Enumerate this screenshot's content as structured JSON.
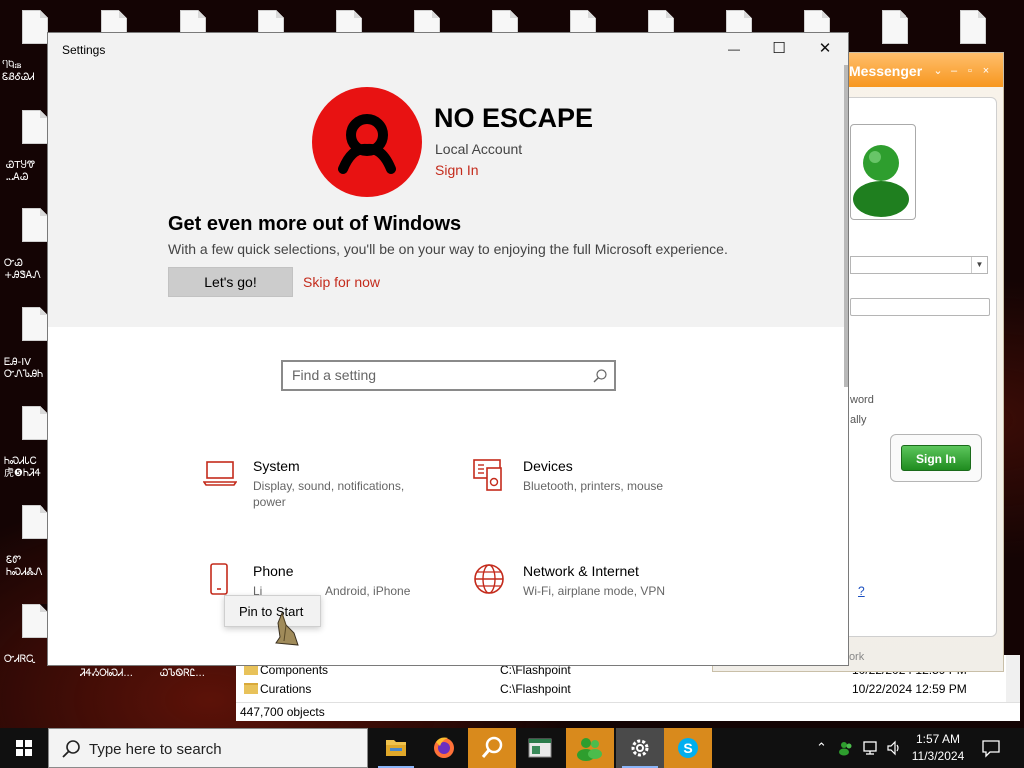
{
  "desktop": {
    "labels": [
      "ႤႩ᎓ᏼ\nᏋᏰᎴᏊᏗ",
      "ᏯTႸᏡ\n᎐᎑ᎪᏊ",
      "ᏅᏊ\n+ᎯᏕᎪᏁ",
      "ᎬᎯ-IV\nᏅᏁᏖᎯᏂ",
      "ᏂᏍᏗᏓᏟ\n虎❺ᏂᏘᏎ",
      "ᏋᏛ\nᏂᏍᏗᏜᏁ",
      "ᏅᏗᏒᏩ",
      "ᏘᏎᏱᎺᏍᏗ...",
      "ᏇᏖᏫᏒᏝ..."
    ]
  },
  "explorer": {
    "rows": [
      {
        "name": "Components",
        "path": "C:\\Flashpoint",
        "date": "10/22/2024 12:59 PM"
      },
      {
        "name": "Curations",
        "path": "C:\\Flashpoint",
        "date": "10/22/2024 12:59 PM"
      }
    ],
    "status": "447,700 objects"
  },
  "messenger": {
    "title": "Messenger",
    "text_word": "word",
    "text_ally": "ally",
    "sign_in": "Sign In",
    "link": "?",
    "bottom": "work"
  },
  "settings": {
    "title": "Settings",
    "controls": {
      "minimize": "—",
      "maximize": "☐",
      "close": "✕"
    },
    "profile": {
      "name": "NO ESCAPE",
      "type": "Local Account",
      "sign_in": "Sign In"
    },
    "promo": {
      "title": "Get even more out of Windows",
      "text": "With a few quick selections, you'll be on your way to enjoying the full Microsoft experience.",
      "lets_go": "Let's go!",
      "skip": "Skip for now"
    },
    "search": {
      "placeholder": "Find a setting"
    },
    "categories": [
      {
        "title": "System",
        "subtitle": "Display, sound, notifications, power"
      },
      {
        "title": "Devices",
        "subtitle": "Bluetooth, printers, mouse"
      },
      {
        "title": "Phone",
        "subtitle_left": "Li",
        "subtitle_right": "Android, iPhone"
      },
      {
        "title": "Network & Internet",
        "subtitle": "Wi-Fi, airplane mode, VPN"
      }
    ],
    "context_menu": {
      "pin_to_start": "Pin to Start"
    }
  },
  "taskbar": {
    "search_placeholder": "Type here to search",
    "time": "1:57 AM",
    "date": "11/3/2024",
    "apps": [
      "file-explorer",
      "firefox",
      "search-tool",
      "app-window",
      "messenger",
      "settings",
      "skype"
    ]
  },
  "colors": {
    "accent": "#c42b1c",
    "avatar": "#e81212",
    "taskbar": "#101010"
  }
}
